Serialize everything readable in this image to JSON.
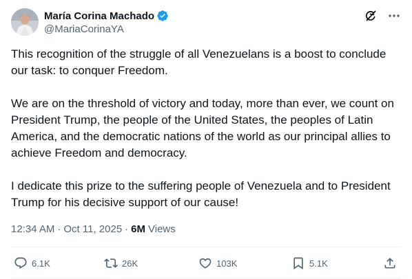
{
  "author": {
    "display_name": "María Corina Machado",
    "handle": "@MariaCorinaYA",
    "verified": true,
    "verified_color": "#1d9bf0"
  },
  "top_actions": {
    "grok_icon": "grok-icon",
    "more_icon": "more-icon"
  },
  "tweet": {
    "paragraphs": [
      "This recognition of the struggle of all Venezuelans is a boost to conclude our task: to conquer Freedom.",
      "We are on the threshold of victory and today, more than ever, we count on President Trump, the people of the United States, the peoples of Latin America, and the democratic nations of the world as our principal allies to achieve Freedom and democracy.",
      "I dedicate this prize to the suffering people of Venezuela and to President Trump for his decisive support of our cause!"
    ]
  },
  "meta": {
    "time": "12:34 AM",
    "separator": "·",
    "date": "Oct 11, 2025",
    "views_count": "6M",
    "views_label": "Views"
  },
  "actions": {
    "replies": "6.1K",
    "reposts": "26K",
    "likes": "103K",
    "bookmarks": "5.1K"
  },
  "colors": {
    "text_primary": "#0f1419",
    "text_secondary": "#536471",
    "divider": "#eff3f4"
  }
}
